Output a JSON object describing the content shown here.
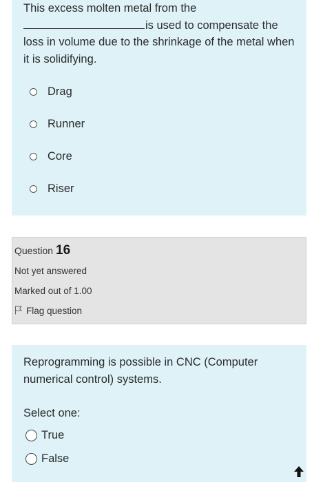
{
  "question15": {
    "text_line1": "This excess molten metal from the",
    "text_after_blank": "is used to compensate the loss in volume due to the shrinkage of the metal when it is solidifying.",
    "options": [
      "Drag",
      "Runner",
      "Core",
      "Riser"
    ]
  },
  "question16_info": {
    "label": "Question",
    "number": "16",
    "status": "Not yet answered",
    "marks": "Marked out of 1.00",
    "flag_label": "Flag question"
  },
  "question16": {
    "text": "Reprogramming is possible in CNC (Computer numerical control) systems.",
    "prompt": "Select one:",
    "options": [
      "True",
      "False"
    ]
  },
  "icons": {
    "flag": "flag-outline-icon",
    "scroll_up": "arrow-up-icon"
  },
  "colors": {
    "question_bg": "#def2f8",
    "info_bg": "#e4e4e4"
  }
}
